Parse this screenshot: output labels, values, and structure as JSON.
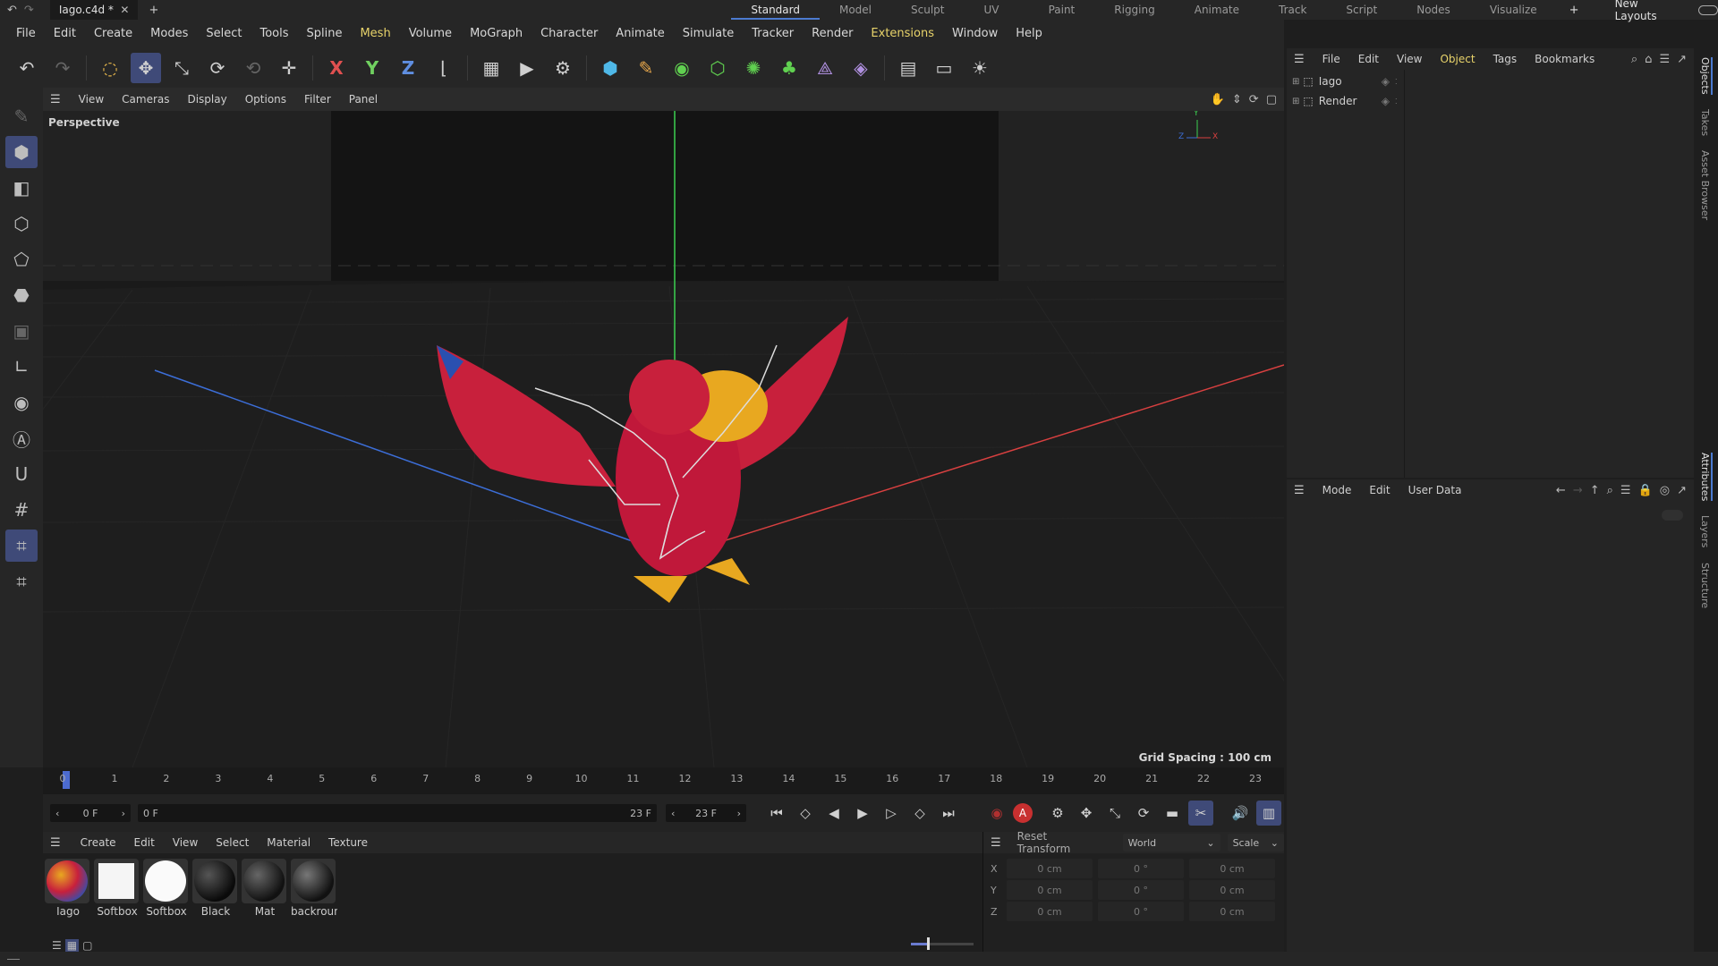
{
  "titlebar": {
    "file_tab": "Iago.c4d *",
    "layouts": [
      "Standard",
      "Model",
      "Sculpt",
      "UV Edit",
      "Paint",
      "Rigging",
      "Animate",
      "Track",
      "Script",
      "Nodes",
      "Visualize"
    ],
    "new_layouts": "New Layouts"
  },
  "menubar": [
    "File",
    "Edit",
    "Create",
    "Modes",
    "Select",
    "Tools",
    "Spline",
    "Mesh",
    "Volume",
    "MoGraph",
    "Character",
    "Animate",
    "Simulate",
    "Tracker",
    "Render",
    "Extensions",
    "Window",
    "Help"
  ],
  "toolbar": {
    "x": "X",
    "y": "Y",
    "z": "Z"
  },
  "viewport_menu": [
    "View",
    "Cameras",
    "Display",
    "Options",
    "Filter",
    "Panel"
  ],
  "viewport": {
    "label": "Perspective",
    "grid_spacing": "Grid Spacing : 100 cm",
    "axis_x": "X",
    "axis_y": "Y",
    "axis_z": "Z"
  },
  "timeline": {
    "ticks": [
      "0",
      "1",
      "2",
      "3",
      "4",
      "5",
      "6",
      "7",
      "8",
      "9",
      "10",
      "11",
      "12",
      "13",
      "14",
      "15",
      "16",
      "17",
      "18",
      "19",
      "20",
      "21",
      "22",
      "23"
    ],
    "current": "0 F",
    "start": "0 F",
    "end": "23 F",
    "end2": "23 F",
    "record_label": "A"
  },
  "material_menu": [
    "Create",
    "Edit",
    "View",
    "Select",
    "Material",
    "Texture"
  ],
  "materials": [
    "Iago",
    "Softbox",
    "Softbox",
    "Black",
    "Mat",
    "backroun"
  ],
  "coords": {
    "reset": "Reset Transform",
    "space": "World",
    "mode": "Scale",
    "axes": [
      "X",
      "Y",
      "Z"
    ],
    "c1": "0 cm",
    "c2": "0 °",
    "c3": "0 cm"
  },
  "objects_menu": [
    "File",
    "Edit",
    "View",
    "Object",
    "Tags",
    "Bookmarks"
  ],
  "objects": [
    "Iago",
    "Render"
  ],
  "attr_menu": [
    "Mode",
    "Edit",
    "User Data"
  ],
  "sidetabs": [
    "Objects",
    "Takes",
    "Asset Browser",
    "Attributes",
    "Layers",
    "Structure"
  ],
  "colors": {
    "accent": "#4c7bd0",
    "selection": "#3f4a78",
    "highlight": "#e8d36a"
  }
}
